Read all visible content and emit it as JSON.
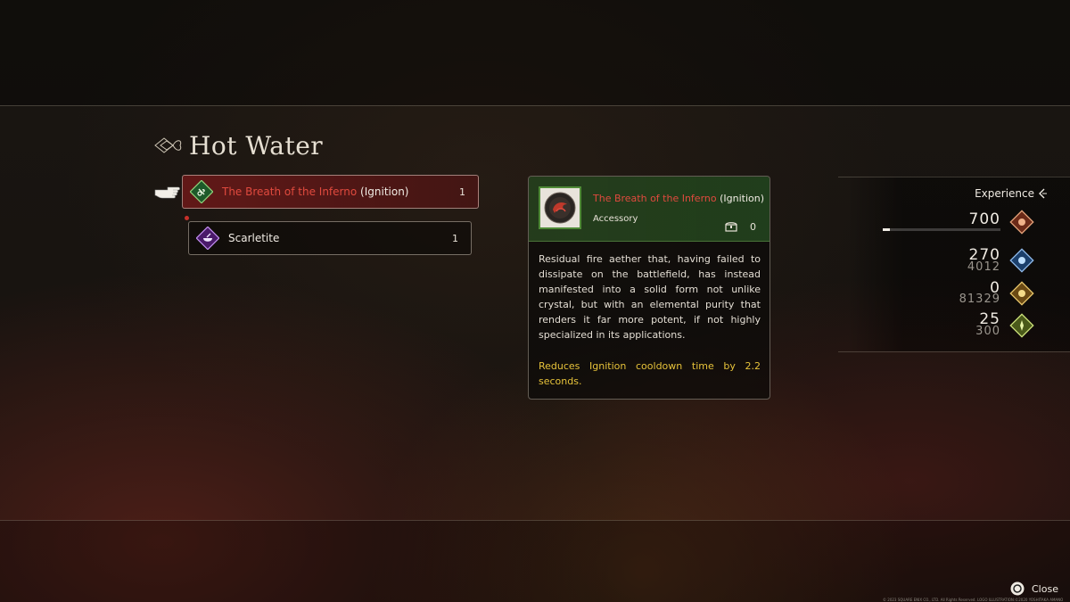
{
  "title": "Hot Water",
  "recipe": {
    "main": {
      "name": "The Breath of the Inferno",
      "suffix": "(Ignition)",
      "count": "1"
    },
    "materials": [
      {
        "name": "Scarletite",
        "count": "1"
      }
    ]
  },
  "detail": {
    "name": "The Breath of the Inferno",
    "suffix": "(Ignition)",
    "category": "Accessory",
    "owned": "0",
    "description": "Residual fire aether that, having failed to dissipate on the battlefield, has instead manifested into a solid form not unlike crystal, but with an elemental purity that renders it far more potent, if not highly specialized in its applications.",
    "effect": "Reduces Ignition cooldown time by 2.2 seconds."
  },
  "experience": {
    "title": "Experience",
    "progress": 0.06,
    "rows": [
      {
        "value": "700",
        "sub": "",
        "icon": "fire-ability-gem-icon"
      },
      {
        "value": "270",
        "sub": "4012",
        "icon": "blue-ability-gem-icon"
      },
      {
        "value": "0",
        "sub": "81329",
        "icon": "gold-ability-gem-icon"
      },
      {
        "value": "25",
        "sub": "300",
        "icon": "green-ability-gem-icon"
      }
    ]
  },
  "footer": {
    "close_label": "Close",
    "copyright": "© 2023 SQUARE ENIX CO., LTD. All Rights Reserved. LOGO ILLUSTRATION:©2020 YOSHITAKA AMANO"
  },
  "colors": {
    "accent_red": "#e04a3e",
    "effect_yellow": "#e6c23a",
    "panel_green": "#4f8a37"
  }
}
